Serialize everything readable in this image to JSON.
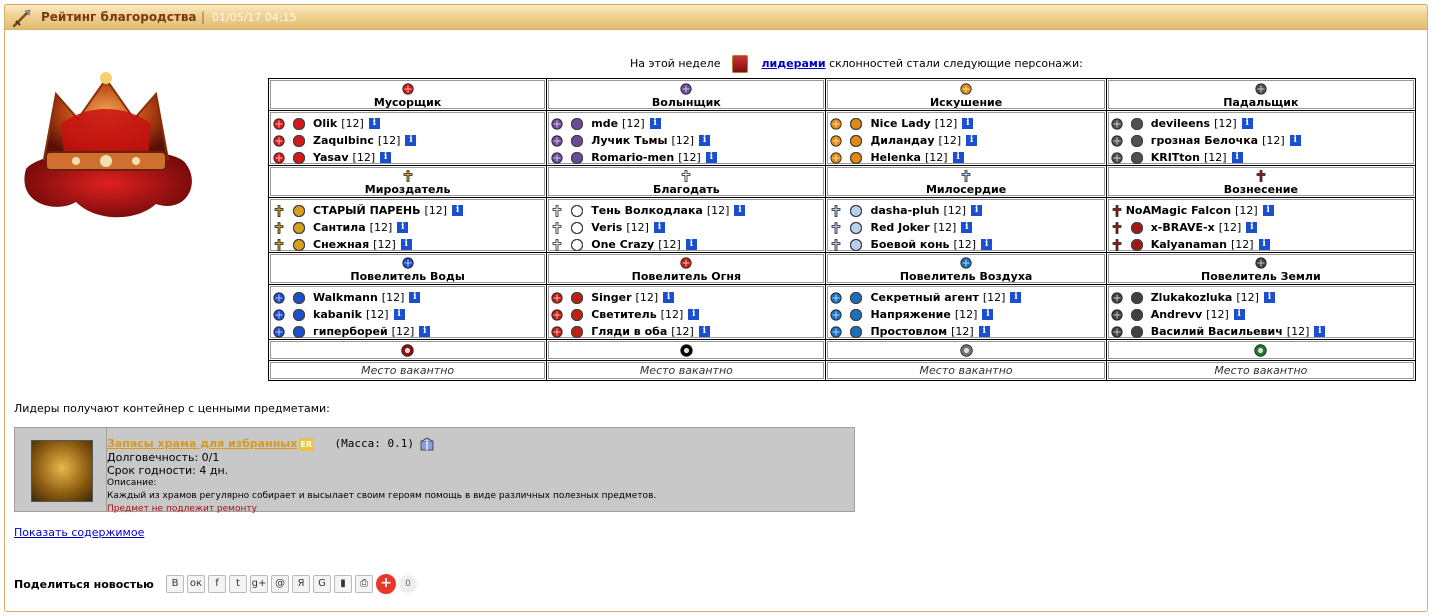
{
  "header": {
    "title": "Рейтинг благородства",
    "separator": "|",
    "date": "01/05/17 04:15"
  },
  "intro": {
    "before": "На этой неделе",
    "link": "лидерами",
    "after": "склонностей стали следующие персонажи:"
  },
  "colors": {
    "header_bg": "#efd192",
    "title": "#7a3a10",
    "link": "#0000cc",
    "item_box": "#c8c8c8",
    "item_name": "#d89a1a"
  },
  "vacant_text": "Место вакантно",
  "rows": [
    {
      "alignments": [
        {
          "name": "Мусорщик",
          "icon": "red-cross-orb-icon",
          "color": "#d81818",
          "players": [
            {
              "nick": "Olik",
              "level": "[12]"
            },
            {
              "nick": "Zaqulbinc",
              "level": "[12]"
            },
            {
              "nick": "Yasav",
              "level": "[12]"
            }
          ]
        },
        {
          "name": "Волынщик",
          "icon": "purple-cross-orb-icon",
          "color": "#6a4a9a",
          "players": [
            {
              "nick": "mde",
              "level": "[12]"
            },
            {
              "nick": "Лучик Тьмы",
              "level": "[12]"
            },
            {
              "nick": "Romario-men",
              "level": "[12]"
            }
          ]
        },
        {
          "name": "Искушение",
          "icon": "orange-orb-icon",
          "color": "#e08a10",
          "players": [
            {
              "nick": "Nice Lady",
              "level": "[12]"
            },
            {
              "nick": "Диландау",
              "level": "[12]"
            },
            {
              "nick": "Helenka",
              "level": "[12]"
            }
          ]
        },
        {
          "name": "Падальщик",
          "icon": "gray-orb-icon",
          "color": "#505050",
          "players": [
            {
              "nick": "devileens",
              "level": "[12]"
            },
            {
              "nick": "грозная Белочка",
              "level": "[12]"
            },
            {
              "nick": "KRITton",
              "level": "[12]"
            }
          ]
        }
      ]
    },
    {
      "alignments": [
        {
          "name": "Мироздатель",
          "icon": "gold-cross-icon",
          "color": "#d8a020",
          "players": [
            {
              "nick": "СТАРЫЙ ПАРЕНЬ",
              "level": "[12]"
            },
            {
              "nick": "Сантила",
              "level": "[12]"
            },
            {
              "nick": "Снежная",
              "level": "[12]"
            }
          ]
        },
        {
          "name": "Благодать",
          "icon": "white-cross-icon",
          "color": "#ffffff",
          "players": [
            {
              "nick": "Тень Волкодлака",
              "level": "[12]"
            },
            {
              "nick": "Veris",
              "level": "[12]"
            },
            {
              "nick": "One Crazy",
              "level": "[12]"
            }
          ]
        },
        {
          "name": "Милосердие",
          "icon": "blue-cross-icon",
          "color": "#b8d0f0",
          "players": [
            {
              "nick": "dasha-pluh",
              "level": "[12]"
            },
            {
              "nick": "Red Joker",
              "level": "[12]"
            },
            {
              "nick": "Боевой конь",
              "level": "[12]"
            }
          ]
        },
        {
          "name": "Вознесение",
          "icon": "red-cross-icon",
          "color": "#a01818",
          "players": [
            {
              "nick": "Magic Falcon",
              "level": "[12]",
              "clan": "NoA"
            },
            {
              "nick": "x-BRAVE-x",
              "level": "[12]"
            },
            {
              "nick": "Kalyanaman",
              "level": "[12]"
            }
          ]
        }
      ]
    },
    {
      "alignments": [
        {
          "name": "Повелитель Воды",
          "icon": "water-swirl-icon",
          "color": "#1a4fd0",
          "players": [
            {
              "nick": "Walkmann",
              "level": "[12]"
            },
            {
              "nick": "kabanik",
              "level": "[12]"
            },
            {
              "nick": "гиперборей",
              "level": "[12]"
            }
          ]
        },
        {
          "name": "Повелитель Огня",
          "icon": "fire-orb-icon",
          "color": "#c02010",
          "players": [
            {
              "nick": "Singer",
              "level": "[12]"
            },
            {
              "nick": "Светитель",
              "level": "[12]"
            },
            {
              "nick": "Гляди в оба",
              "level": "[12]"
            }
          ]
        },
        {
          "name": "Повелитель Воздуха",
          "icon": "air-orb-icon",
          "color": "#1a70c0",
          "players": [
            {
              "nick": "Секретный агент",
              "level": "[12]"
            },
            {
              "nick": "Напряжение",
              "level": "[12]"
            },
            {
              "nick": "Простовлом",
              "level": "[12]"
            }
          ]
        },
        {
          "name": "Повелитель Земли",
          "icon": "earth-totem-icon",
          "color": "#404040",
          "players": [
            {
              "nick": "Zlukakozluka",
              "level": "[12]"
            },
            {
              "nick": "Andrevv",
              "level": "[12]"
            },
            {
              "nick": "Василий Васильевич",
              "level": "[12]"
            }
          ]
        }
      ]
    }
  ],
  "vacant_icons": [
    {
      "icon": "demon-mask-icon",
      "color": "#8a1010"
    },
    {
      "icon": "yin-yang-icon",
      "color": "#000000"
    },
    {
      "icon": "gray-badge-icon",
      "color": "#707070"
    },
    {
      "icon": "green-badge-icon",
      "color": "#1a7a2a"
    }
  ],
  "reward": {
    "label": "Лидеры получают контейнер с ценными предметами:",
    "name": "Запасы храма для избранных",
    "er": "ER",
    "mass": "(Масса: 0.1)",
    "durability": "Долговечность: 0/1",
    "expiry": "Срок годности: 4 дн.",
    "desc_label": "Описание:",
    "desc": "Каждый из храмов регулярно собирает и высылает своим героям помощь в виде различных полезных предметов.",
    "no_repair": "Предмет не подлежит ремонту"
  },
  "show_contents": "Показать содержимое",
  "share": {
    "label": "Поделиться новостью",
    "buttons": [
      {
        "label": "В",
        "name": "vk-share-button"
      },
      {
        "label": "ок",
        "name": "odnoklassniki-share-button"
      },
      {
        "label": "f",
        "name": "facebook-share-button"
      },
      {
        "label": "t",
        "name": "twitter-share-button"
      },
      {
        "label": "g+",
        "name": "googleplus-share-button"
      },
      {
        "label": "@",
        "name": "mail-share-button"
      },
      {
        "label": "Я",
        "name": "yandex-share-button"
      },
      {
        "label": "G",
        "name": "gmail-share-button"
      },
      {
        "label": "▮",
        "name": "bookmark-share-button"
      },
      {
        "label": "⎙",
        "name": "print-share-button"
      }
    ],
    "plus": "+",
    "count": "0"
  }
}
